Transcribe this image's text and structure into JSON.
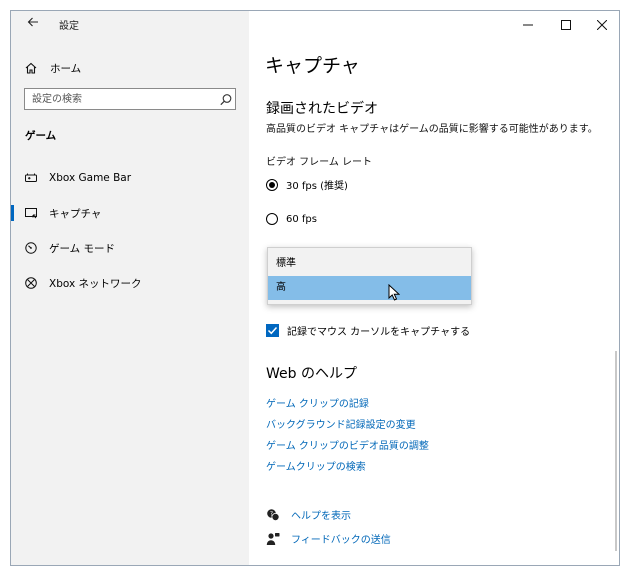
{
  "window": {
    "title": "設定"
  },
  "colors": {
    "accent": "#0067c0",
    "link": "#0067b8",
    "selected_option": "#84bde8",
    "sidebar_bg": "#f2f2f2"
  },
  "sidebar": {
    "home_label": "ホーム",
    "search_placeholder": "設定の検索",
    "section_heading": "ゲーム",
    "items": [
      {
        "label": "Xbox Game Bar",
        "icon": "xbox-game-bar-icon",
        "selected": false
      },
      {
        "label": "キャプチャ",
        "icon": "capture-icon",
        "selected": true
      },
      {
        "label": "ゲーム モード",
        "icon": "game-mode-icon",
        "selected": false
      },
      {
        "label": "Xbox ネットワーク",
        "icon": "xbox-network-icon",
        "selected": false
      }
    ]
  },
  "main": {
    "page_title": "キャプチャ",
    "recorded_video": {
      "title": "録画されたビデオ",
      "description": "高品質のビデオ キャプチャはゲームの品質に影響する可能性があります。",
      "frame_rate_label": "ビデオ フレーム レート",
      "options": [
        {
          "label": "30 fps (推奨)",
          "checked": true
        },
        {
          "label": "60 fps",
          "checked": false
        }
      ],
      "quality_dropdown": {
        "options": [
          "標準",
          "高"
        ],
        "highlighted": "高"
      },
      "mouse_cursor_checkbox": {
        "label": "記録でマウス カーソルをキャプチャする",
        "checked": true
      }
    },
    "web_help": {
      "title": "Web のヘルプ",
      "links": [
        "ゲーム クリップの記録",
        "バックグラウンド記録設定の変更",
        "ゲーム クリップのビデオ品質の調整",
        "ゲームクリップの検索"
      ]
    },
    "footer": {
      "get_help": "ヘルプを表示",
      "give_feedback": "フィードバックの送信"
    }
  }
}
